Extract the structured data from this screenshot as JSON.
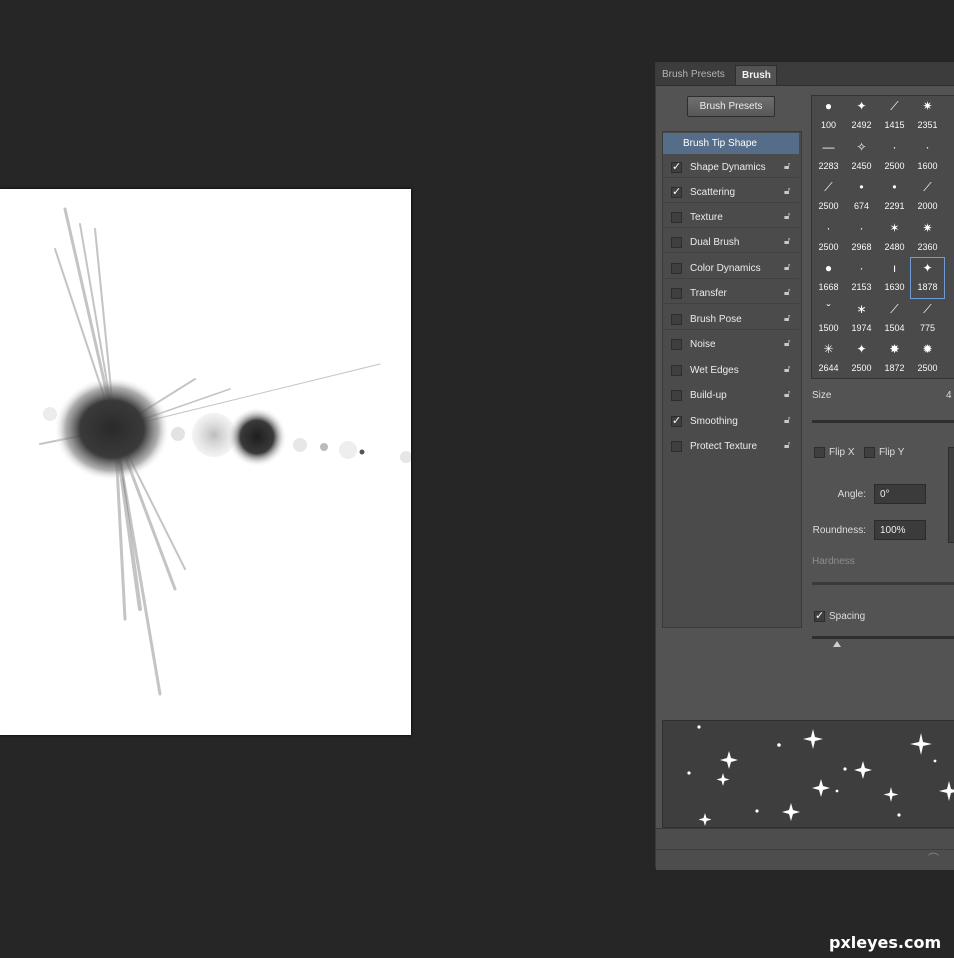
{
  "tabs": [
    {
      "label": "Brush Presets"
    },
    {
      "label": "Brush"
    }
  ],
  "brush_presets_button": "Brush Presets",
  "options": [
    {
      "label": "Brush Tip Shape",
      "selected": true
    },
    {
      "label": "Shape Dynamics",
      "checked": true
    },
    {
      "label": "Scattering",
      "checked": true
    },
    {
      "label": "Texture",
      "checked": false
    },
    {
      "label": "Dual Brush",
      "checked": false
    },
    {
      "label": "Color Dynamics",
      "checked": false
    },
    {
      "label": "Transfer",
      "checked": false
    },
    {
      "label": "Brush Pose",
      "checked": false
    },
    {
      "label": "Noise",
      "checked": false
    },
    {
      "label": "Wet Edges",
      "checked": false
    },
    {
      "label": "Build-up",
      "checked": false
    },
    {
      "label": "Smoothing",
      "checked": true
    },
    {
      "label": "Protect Texture",
      "checked": false
    }
  ],
  "brush_tips": [
    {
      "size": "100",
      "icon": "●"
    },
    {
      "size": "2492",
      "icon": "✦"
    },
    {
      "size": "1415",
      "icon": "⟋"
    },
    {
      "size": "2351",
      "icon": "✷"
    },
    {
      "size": "2283",
      "icon": "—"
    },
    {
      "size": "2450",
      "icon": "✧"
    },
    {
      "size": "2500",
      "icon": "·"
    },
    {
      "size": "1600",
      "icon": "·"
    },
    {
      "size": "2500",
      "icon": "⟋"
    },
    {
      "size": "674",
      "icon": "•"
    },
    {
      "size": "2291",
      "icon": "•"
    },
    {
      "size": "2000",
      "icon": "⟋"
    },
    {
      "size": "2500",
      "icon": "·"
    },
    {
      "size": "2968",
      "icon": "·"
    },
    {
      "size": "2480",
      "icon": "✶"
    },
    {
      "size": "2360",
      "icon": "✷"
    },
    {
      "size": "1668",
      "icon": "●"
    },
    {
      "size": "2153",
      "icon": "·"
    },
    {
      "size": "1630",
      "icon": "ı"
    },
    {
      "size": "1878",
      "icon": "✦",
      "selected": true
    },
    {
      "size": "1500",
      "icon": "ˇ"
    },
    {
      "size": "1974",
      "icon": "∗"
    },
    {
      "size": "1504",
      "icon": "⟋"
    },
    {
      "size": "775",
      "icon": "⟋"
    },
    {
      "size": "2644",
      "icon": "✳"
    },
    {
      "size": "2500",
      "icon": "✦"
    },
    {
      "size": "1872",
      "icon": "✸"
    },
    {
      "size": "2500",
      "icon": "✹"
    }
  ],
  "size_label": "Size",
  "size_value": "4",
  "flip_x": "Flip X",
  "flip_y": "Flip Y",
  "angle_label": "Angle:",
  "angle_value": "0°",
  "roundness_label": "Roundness:",
  "roundness_value": "100%",
  "hardness_label": "Hardness",
  "spacing_label": "Spacing",
  "spacing_checked": "✓",
  "watermark": "pxleyes.com"
}
